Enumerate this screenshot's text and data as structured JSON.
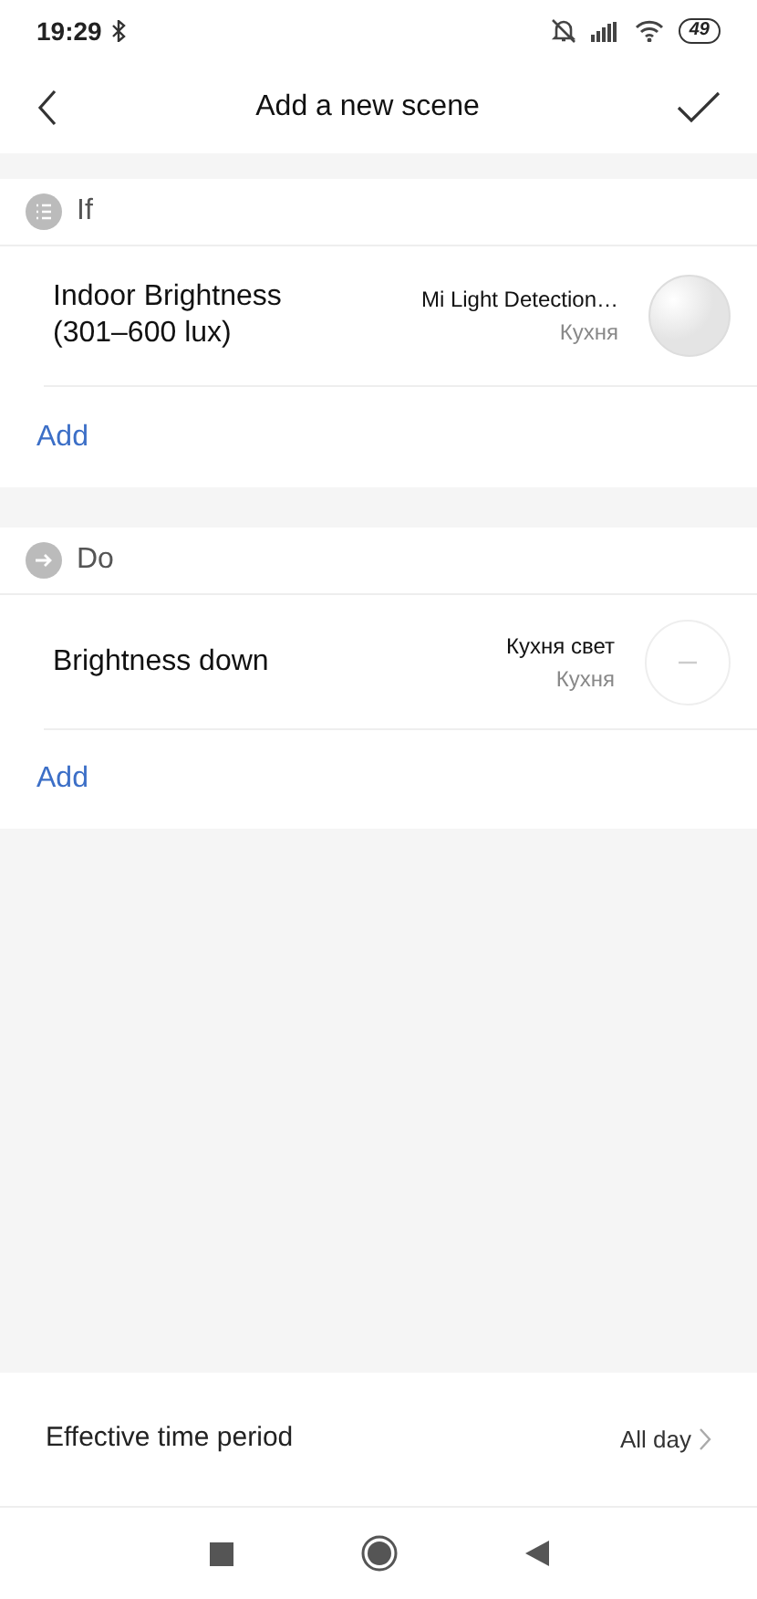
{
  "status_bar": {
    "time": "19:29",
    "battery": "49"
  },
  "header": {
    "title": "Add a new scene"
  },
  "sections": [
    {
      "kind": "if",
      "label": "If",
      "items": [
        {
          "title": "Indoor Brightness\n(301–600 lux)",
          "device": "Mi Light Detection…",
          "room": "Кухня",
          "kind": "sensor"
        }
      ],
      "add": "Add"
    },
    {
      "kind": "do",
      "label": "Do",
      "items": [
        {
          "title": "Brightness down",
          "device": "Кухня свет",
          "room": "Кухня",
          "kind": "lamp"
        }
      ],
      "add": "Add"
    }
  ],
  "time_period": {
    "label": "Effective time period",
    "value": "All day"
  }
}
